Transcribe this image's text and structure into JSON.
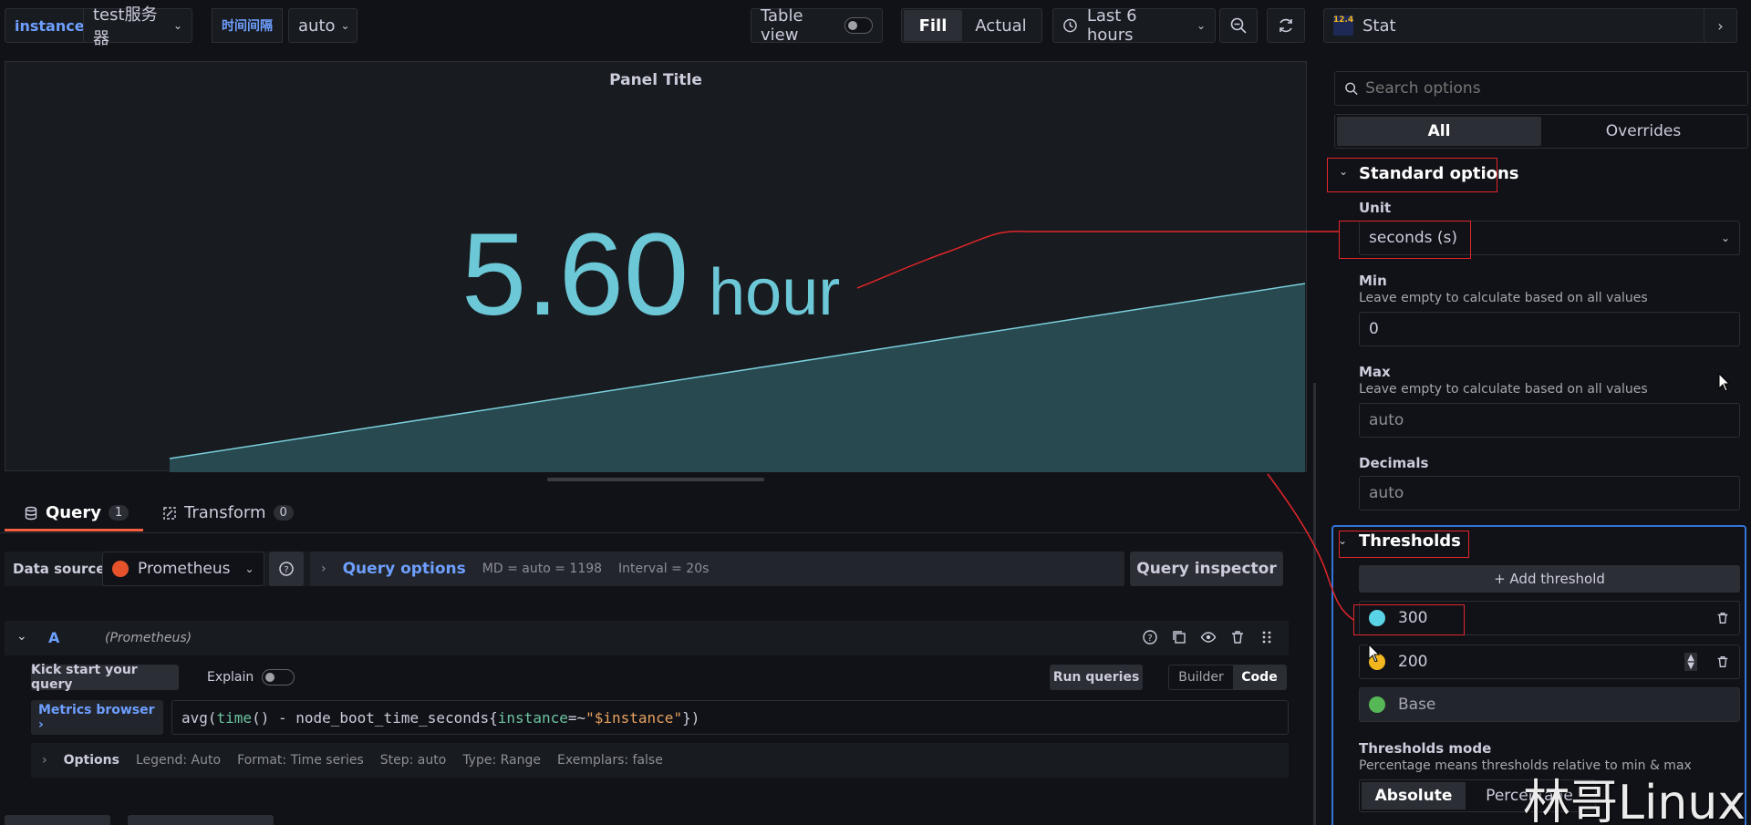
{
  "toolbar": {
    "var1_label": "instance",
    "var1_value": "test服务器",
    "var2_label": "时间间隔",
    "var2_value": "auto",
    "table_view_label": "Table view",
    "fill_label": "Fill",
    "actual_label": "Actual",
    "time_range": "Last 6 hours"
  },
  "panel": {
    "title": "Panel Title",
    "stat_value": "5.60",
    "stat_unit": "hour",
    "value_color": "#6cc7d6"
  },
  "query_tabs": [
    {
      "label": "Query",
      "count": "1"
    },
    {
      "label": "Transform",
      "count": "0"
    }
  ],
  "datasource_row": {
    "label": "Data source",
    "datasource": "Prometheus",
    "query_options_label": "Query options",
    "md_text": "MD = auto = 1198",
    "interval_text": "Interval = 20s",
    "inspector_label": "Query inspector"
  },
  "query": {
    "ref_id": "A",
    "ds_hint": "(Prometheus)",
    "kick_start_label": "Kick start your query",
    "explain_label": "Explain",
    "run_label": "Run queries",
    "builder_label": "Builder",
    "code_label": "Code",
    "metrics_browser_label": "Metrics browser ›",
    "expr_fn1": "avg(",
    "expr_fn2": "time",
    "expr_mid": "() - node_boot_time_seconds{",
    "expr_key": "instance",
    "expr_op": "=~",
    "expr_val": "\"$instance\"",
    "expr_end": "})",
    "options_label": "Options",
    "options_legend": "Legend: Auto",
    "options_format": "Format: Time series",
    "options_step": "Step: auto",
    "options_type": "Type: Range",
    "options_exemplars": "Exemplars: false"
  },
  "options_pane": {
    "viz_version": "12.4",
    "viz_name": "Stat",
    "search_placeholder": "Search options",
    "tab_all": "All",
    "tab_overrides": "Overrides",
    "standard_section": "Standard options",
    "unit_label": "Unit",
    "unit_value": "seconds (s)",
    "min_label": "Min",
    "min_desc": "Leave empty to calculate based on all values",
    "min_value": "0",
    "max_label": "Max",
    "max_desc": "Leave empty to calculate based on all values",
    "max_placeholder": "auto",
    "decimals_label": "Decimals",
    "decimals_placeholder": "auto",
    "thresholds_section": "Thresholds",
    "add_threshold_label": "+ Add threshold",
    "thresholds": [
      {
        "value": "300",
        "color": "#5ad3e6"
      },
      {
        "value": "200",
        "color": "#f2b61e"
      },
      {
        "value": "Base",
        "color": "#56b757"
      }
    ],
    "thresholds_mode_label": "Thresholds mode",
    "thresholds_mode_desc": "Percentage means thresholds relative to min & max",
    "mode_absolute": "Absolute",
    "mode_percentage": "Percentage"
  },
  "watermark": "林哥Linux"
}
